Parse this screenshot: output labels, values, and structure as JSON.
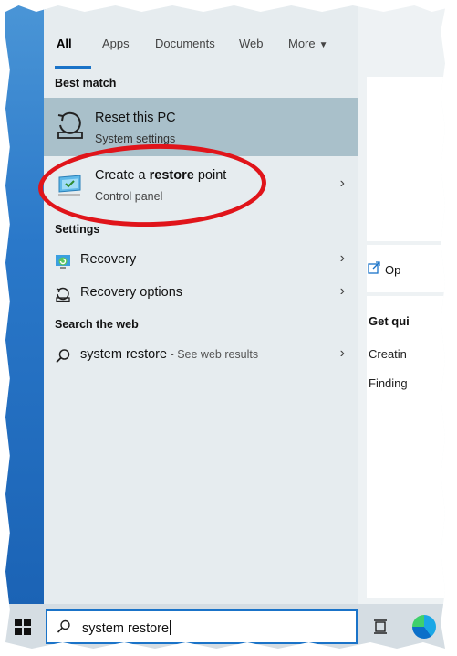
{
  "tabs": [
    {
      "label": "All",
      "active": true
    },
    {
      "label": "Apps"
    },
    {
      "label": "Documents"
    },
    {
      "label": "Web"
    },
    {
      "label": "More"
    }
  ],
  "sections": {
    "best_match": "Best match",
    "settings": "Settings",
    "search_web": "Search the web"
  },
  "best_match_item": {
    "title": "Reset this PC",
    "subtitle": "System settings",
    "icon": "reset-pc-icon"
  },
  "restore_item": {
    "title_prefix": "Create a ",
    "title_bold": "restore",
    "title_suffix": " point",
    "subtitle": "Control panel",
    "icon": "system-properties-icon"
  },
  "settings_items": [
    {
      "label": "Recovery",
      "icon": "recovery-icon"
    },
    {
      "label": "Recovery options",
      "icon": "recovery-options-icon"
    }
  ],
  "web_item": {
    "query": "system restore",
    "hint": " - See web results",
    "icon": "search-icon"
  },
  "right_pane": {
    "open_label": "Op",
    "quick_title": "Get qui",
    "quick_items": [
      "Creatin",
      "Finding"
    ]
  },
  "search_box": {
    "value": "system restore"
  },
  "colors": {
    "accent": "#1a73c8",
    "selected_bg": "#a9c0ca",
    "annotation": "#e0141a"
  }
}
